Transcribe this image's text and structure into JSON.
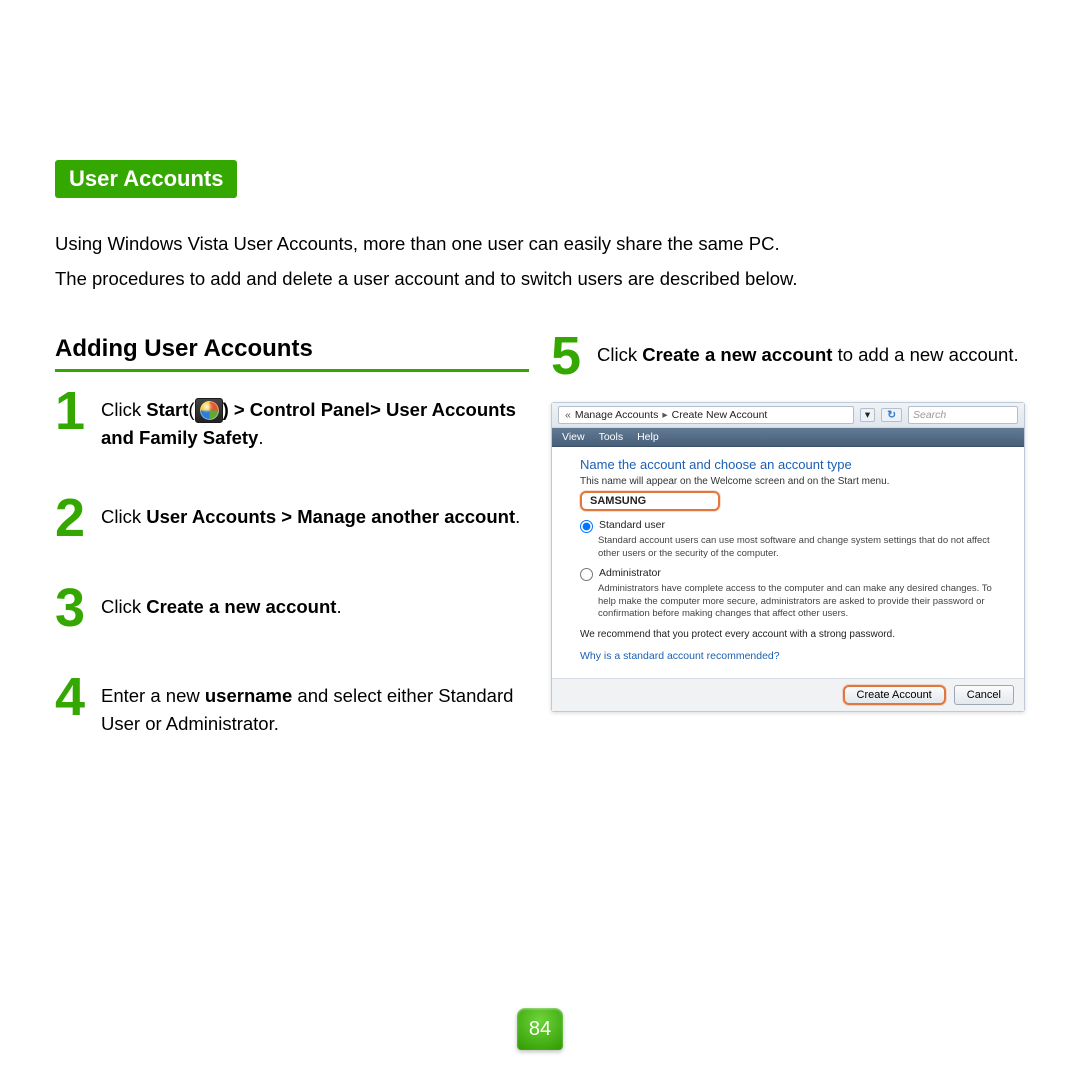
{
  "section_title": "User Accounts",
  "intro": {
    "p1": "Using Windows Vista User Accounts, more than one user can easily share the same PC.",
    "p2": "The procedures to add and delete a user account and to switch users are described below."
  },
  "subheading": "Adding User Accounts",
  "steps_left": [
    {
      "num": "1",
      "pre": "Click ",
      "b1": "Start",
      "mid": "(",
      "b2": ") > Control Panel> User Accounts and Family Safety",
      "post": "."
    },
    {
      "num": "2",
      "pre": "Click ",
      "b1": "User Accounts > Manage another account",
      "post": "."
    },
    {
      "num": "3",
      "pre": "Click ",
      "b1": "Create a new account",
      "post": "."
    },
    {
      "num": "4",
      "pre": "Enter a new ",
      "b1": "username",
      "post": " and select either Standard User or Administrator."
    }
  ],
  "step_right": {
    "num": "5",
    "pre": "Click ",
    "b1": "Create a new account",
    "post": " to add a new account."
  },
  "vista": {
    "breadcrumb": {
      "back": "«",
      "a": "Manage Accounts",
      "sep": "▸",
      "b": "Create New Account"
    },
    "dropdown": "▾",
    "go": "↻",
    "search_placeholder": "Search",
    "menu": [
      "View",
      "Tools",
      "Help"
    ],
    "title": "Name the account and choose an account type",
    "subtitle": "This name will appear on the Welcome screen and on the Start menu.",
    "input_value": "SAMSUNG",
    "opt1_label": "Standard user",
    "opt1_desc": "Standard account users can use most software and change system settings that do not affect other users or the security of the computer.",
    "opt2_label": "Administrator",
    "opt2_desc": "Administrators have complete access to the computer and can make any desired changes. To help make the computer more secure, administrators are asked to provide their password or confirmation before making changes that affect other users.",
    "recommend": "We recommend that you protect every account with a strong password.",
    "link": "Why is a standard account recommended?",
    "btn_create": "Create Account",
    "btn_cancel": "Cancel"
  },
  "page_number": "84"
}
